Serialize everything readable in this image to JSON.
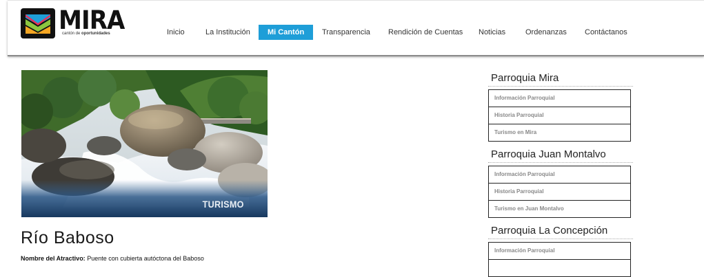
{
  "logo": {
    "name": "MIRA",
    "tagline_prefix": "cantón de",
    "tagline_bold": "oportunidades"
  },
  "nav": {
    "items": [
      {
        "label": "Inicio",
        "active": false
      },
      {
        "label": "La Institución",
        "active": false
      },
      {
        "label": "Mi Cantón",
        "active": true
      },
      {
        "label": "Transparencia",
        "active": false
      },
      {
        "label": "Rendición de Cuentas",
        "active": false
      },
      {
        "label": "Noticias",
        "active": false
      },
      {
        "label": "Ordenanzas",
        "active": false
      },
      {
        "label": "Contáctanos",
        "active": false
      }
    ],
    "active_color": "#1e9ed8"
  },
  "hero": {
    "caption": "TURISMO"
  },
  "main": {
    "title": "Río Baboso",
    "attribute_label": "Nombre del Atractivo:",
    "attribute_value": "Puente con cubierta autóctona del Baboso"
  },
  "sidebar": {
    "sections": [
      {
        "title": "Parroquia Mira",
        "links": [
          "Información Parroquial",
          "Historia Parroquial",
          "Turismo en Mira"
        ]
      },
      {
        "title": "Parroquia Juan Montalvo",
        "links": [
          "Información Parroquial",
          "Historia Parroquial",
          "Turismo en Juan Montalvo"
        ]
      },
      {
        "title": "Parroquia La Concepción",
        "links": [
          "Información Parroquial",
          ""
        ]
      }
    ]
  }
}
